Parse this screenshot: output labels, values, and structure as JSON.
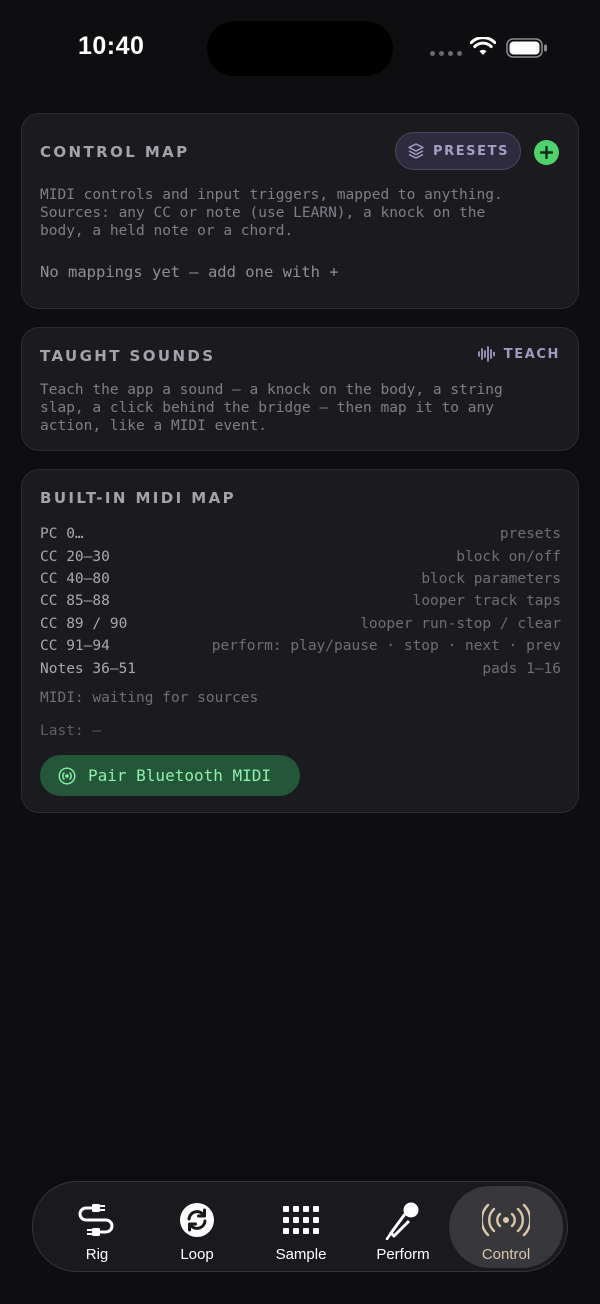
{
  "status_bar": {
    "time": "10:40"
  },
  "control_map": {
    "title": "CONTROL MAP",
    "presets_label": "PRESETS",
    "add_icon": "plus-icon",
    "description": "MIDI controls and input triggers, mapped to anything.\nSources: any CC or note (use LEARN), a knock on the\nbody, a held note or a chord.",
    "empty_message": "No mappings yet — add one with +"
  },
  "taught_sounds": {
    "title": "TAUGHT SOUNDS",
    "teach_label": "TEACH",
    "description": "Teach the app a sound — a knock on the body, a string\nslap, a click behind the bridge — then map it to any\naction, like a MIDI event."
  },
  "midi_map": {
    "title": "BUILT-IN MIDI MAP",
    "rows": [
      {
        "key": "PC 0…",
        "value": "presets"
      },
      {
        "key": "CC 20–30",
        "value": "block on/off"
      },
      {
        "key": "CC 40–80",
        "value": "block parameters"
      },
      {
        "key": "CC 85–88",
        "value": "looper track taps"
      },
      {
        "key": "CC 89 / 90",
        "value": "looper run-stop / clear"
      },
      {
        "key": "CC 91–94",
        "value": "perform: play/pause · stop · next · prev"
      },
      {
        "key": "Notes 36–51",
        "value": "pads 1–16"
      }
    ],
    "status": "MIDI: waiting for sources",
    "last": "Last: —",
    "pair_label": "Pair Bluetooth MIDI"
  },
  "tabs": [
    {
      "label": "Rig",
      "icon": "cable-icon"
    },
    {
      "label": "Loop",
      "icon": "loop-icon"
    },
    {
      "label": "Sample",
      "icon": "grid-icon"
    },
    {
      "label": "Perform",
      "icon": "microphone-icon"
    },
    {
      "label": "Control",
      "icon": "broadcast-icon"
    }
  ],
  "active_tab": "Control",
  "colors": {
    "background": "#0e0e10",
    "card": "#1b1b1f",
    "accent_green": "#4fd16e",
    "presets_purple": "#a49fc6",
    "active_tab_label": "#d9c8a8"
  }
}
